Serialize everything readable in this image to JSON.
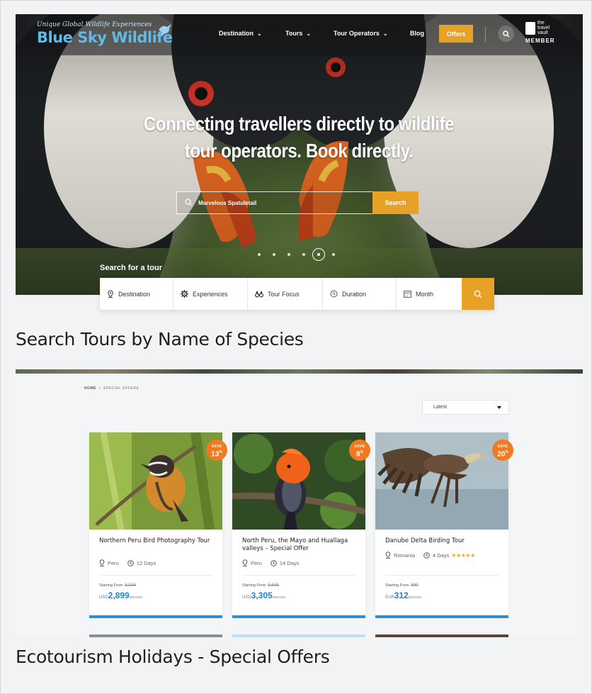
{
  "hero": {
    "logo_tagline": "Unique Global Wildlife Experiences",
    "logo_name": "Blue Sky Wildlife",
    "nav": [
      {
        "label": "Destination",
        "has_dropdown": true
      },
      {
        "label": "Tours",
        "has_dropdown": true
      },
      {
        "label": "Tour Operators",
        "has_dropdown": true
      },
      {
        "label": "Blog",
        "has_dropdown": false
      }
    ],
    "offers_label": "Offers",
    "vault_small": [
      "the",
      "travel",
      "vault"
    ],
    "vault_member": "MEMBER",
    "headline_line1": "Connecting travellers directly to wildlife",
    "headline_line2": "tour operators. Book directly.",
    "search_value": "Marvelous Spatuletail",
    "search_button": "Search",
    "slider_dots": 6,
    "slider_active_index": 5,
    "search_for_tour": "Search for a tour",
    "filters": [
      {
        "label": "Destination",
        "icon": "map-pin-icon"
      },
      {
        "label": "Experiences",
        "icon": "gear-icon"
      },
      {
        "label": "Tour Focus",
        "icon": "binoculars-icon"
      },
      {
        "label": "Duration",
        "icon": "clock-icon"
      },
      {
        "label": "Month",
        "icon": "calendar-icon"
      }
    ]
  },
  "captions": {
    "first": "Search Tours by Name of Species",
    "second": "Ecotourism Holidays - Special Offers"
  },
  "offers": {
    "breadcrumb_home": "HOME",
    "breadcrumb_sep": "/",
    "breadcrumb_current": "SPECIAL OFFERS",
    "sort_value": "Latest",
    "cards": [
      {
        "save_label": "SAVE",
        "save_value": "13",
        "save_unit": "%",
        "title": "Northern Peru Bird Photography Tour",
        "location": "Peru",
        "duration": "12 Days",
        "stars": "",
        "from_label": "Starting From",
        "old_price": "3,335",
        "currency": "USD",
        "price": "2,899",
        "per": "/person"
      },
      {
        "save_label": "SAVE",
        "save_value": "9",
        "save_unit": "%",
        "title": "North Peru, the Mayo and Huallaga valleys – Special Offer",
        "location": "Peru",
        "duration": "14 Days",
        "stars": "",
        "from_label": "Starting From",
        "old_price": "3,635",
        "currency": "USD",
        "price": "3,305",
        "per": "/person"
      },
      {
        "save_label": "SAVE",
        "save_value": "20",
        "save_unit": "%",
        "title": "Danube Delta Birding Tour",
        "location": "Romania",
        "duration": "4 Days",
        "stars": "★★★★★",
        "from_label": "Starting From",
        "old_price": "390",
        "currency": "EUR",
        "price": "312",
        "per": "/person"
      }
    ]
  },
  "colors": {
    "accent_orange": "#e8a127",
    "badge_orange": "#f07a22",
    "price_blue": "#1f86cf",
    "logo_blue": "#62b8e6"
  }
}
